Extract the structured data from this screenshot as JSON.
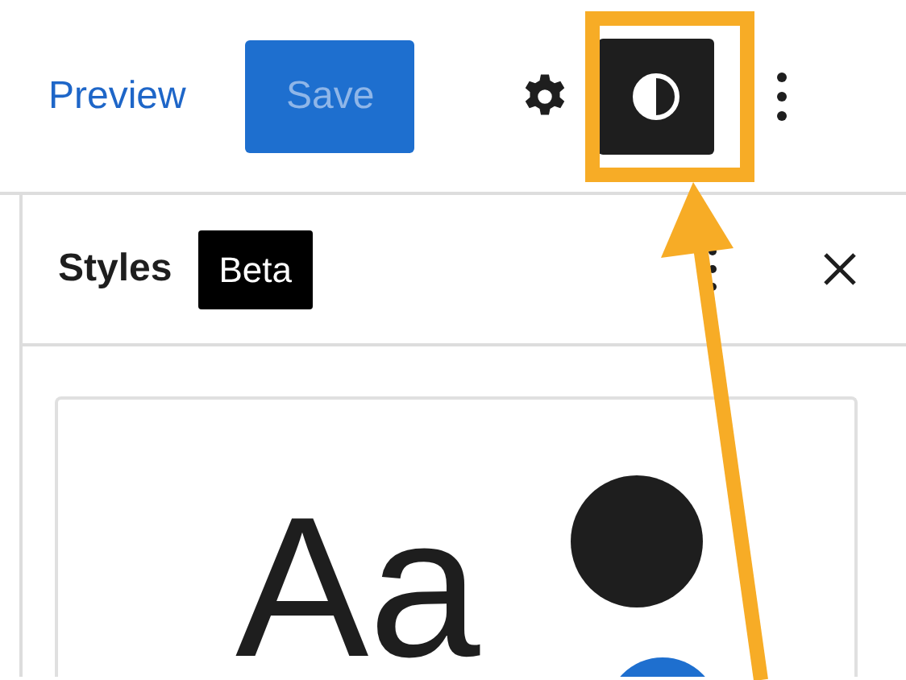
{
  "toolbar": {
    "preview_link": "Preview",
    "save_button": {
      "label": "Save",
      "disabled": true
    },
    "styles_button": {
      "selected": true
    }
  },
  "styles_panel": {
    "title": "Styles",
    "badge": "Beta",
    "preview": {
      "sample_text": "Aa"
    }
  },
  "annotation": {
    "highlight": true,
    "arrow": true
  }
}
